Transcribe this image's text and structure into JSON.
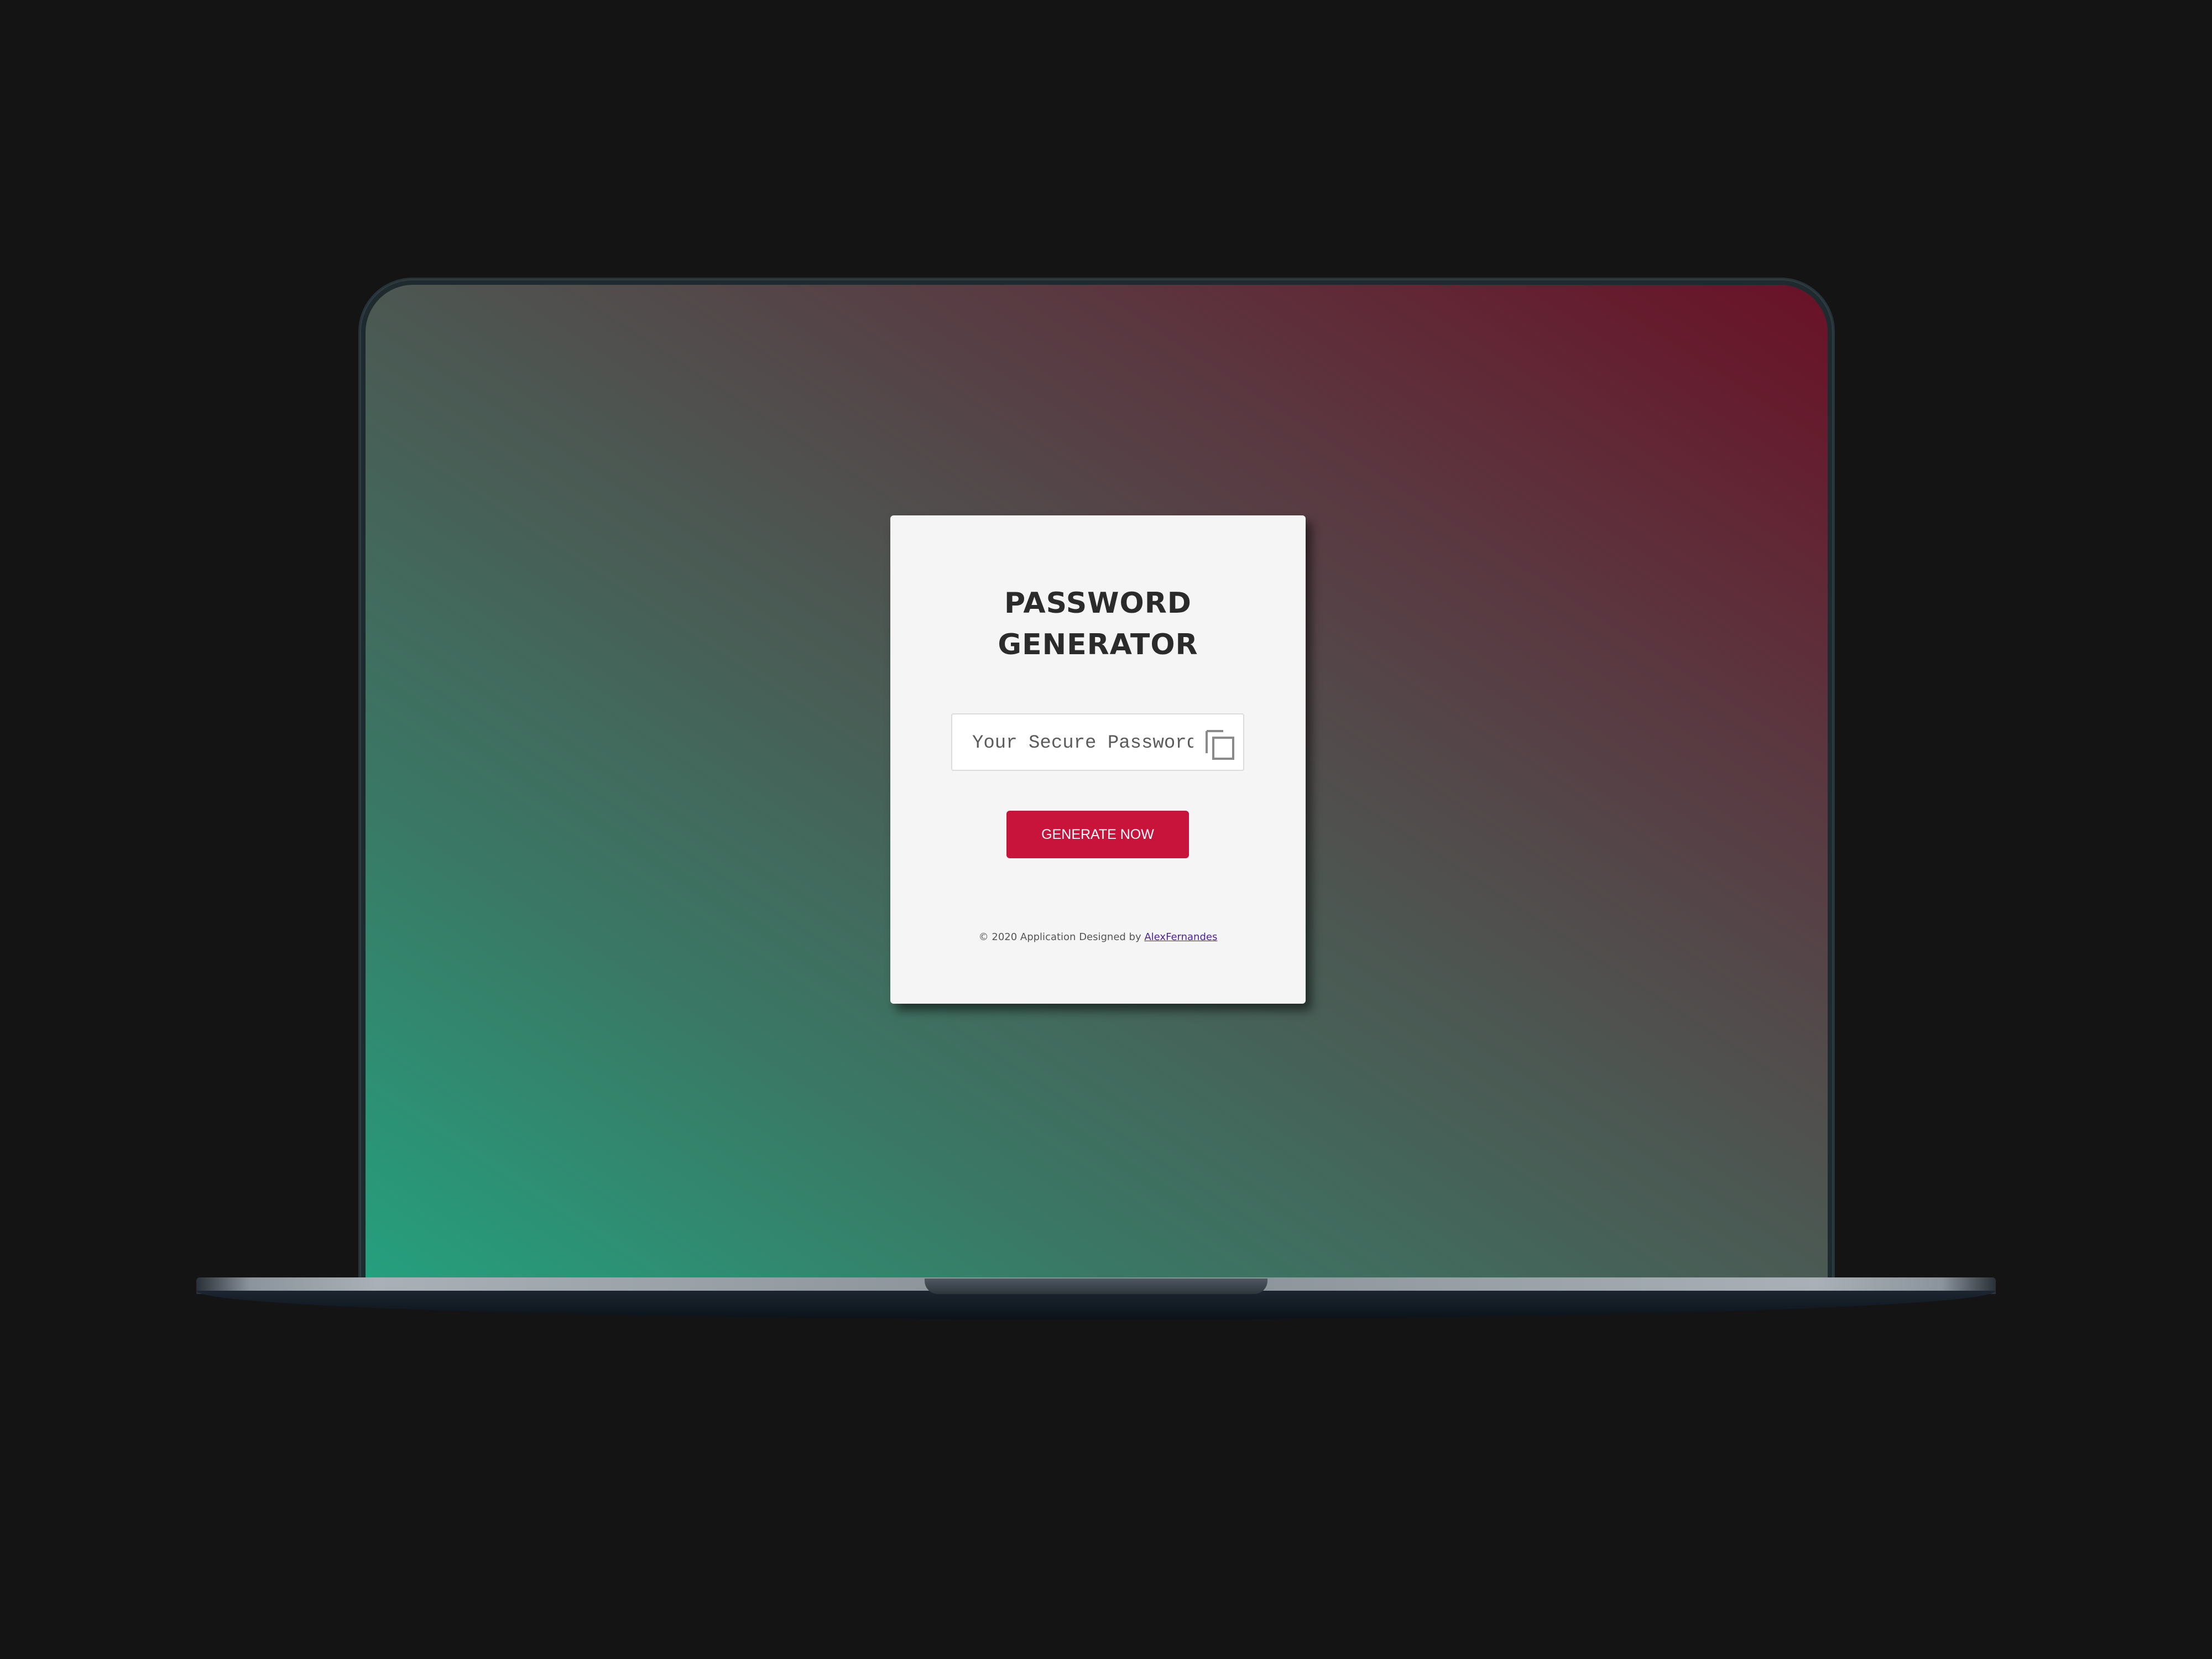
{
  "app": {
    "title_line1": "PASSWORD",
    "title_line2": "GENERATOR",
    "password_placeholder": "Your Secure Password",
    "password_value": "",
    "generate_button_label": "GENERATE NOW",
    "footer_text": "© 2020 Application Designed by ",
    "footer_link_text": "AlexFernandes",
    "copy_icon": "copy-icon"
  },
  "colors": {
    "accent": "#c8143a",
    "card_background": "#f5f5f5",
    "gradient_start": "#25a07e",
    "gradient_end": "#6a1126",
    "link": "#4b1ea0"
  }
}
